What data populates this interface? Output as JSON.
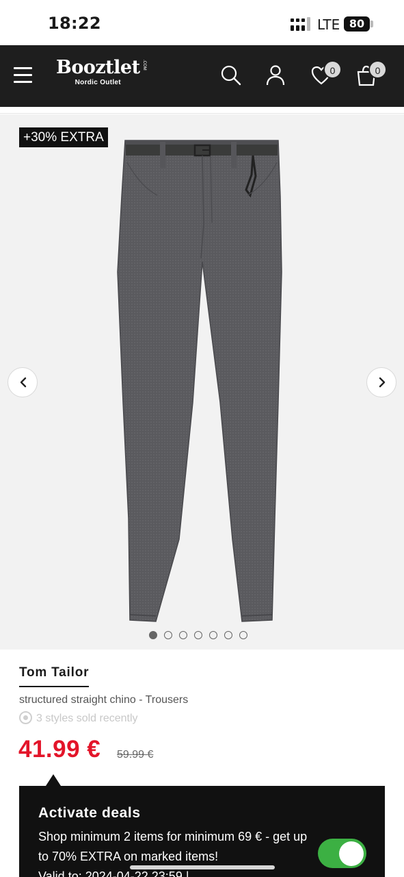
{
  "status_bar": {
    "time": "18:22",
    "network": "LTE",
    "battery": "80"
  },
  "header": {
    "logo_main": "Booztlet",
    "logo_com": ".COM",
    "logo_sub": "Nordic Outlet",
    "wishlist_count": "0",
    "cart_count": "0",
    "icons": [
      "menu-icon",
      "search-icon",
      "user-icon",
      "heart-icon",
      "bag-icon"
    ]
  },
  "gallery": {
    "badge": "+30% EXTRA",
    "image_count": 7,
    "active_index": 0
  },
  "product": {
    "brand": "Tom Tailor",
    "name": "structured straight chino - Trousers",
    "sold_recently": "3 styles sold recently",
    "price": "41.99 €",
    "old_price": "59.99 €"
  },
  "deals": {
    "title": "Activate deals",
    "text": "Shop minimum 2 items for minimum 69 € - get up to 70% EXTRA on marked items!",
    "valid": "Valid to: 2024-04-22 23:59 |",
    "toggle_on": true
  },
  "colors": {
    "header_bg": "#1e1e1e",
    "price_red": "#e3152a",
    "toggle_green": "#3cb043"
  }
}
